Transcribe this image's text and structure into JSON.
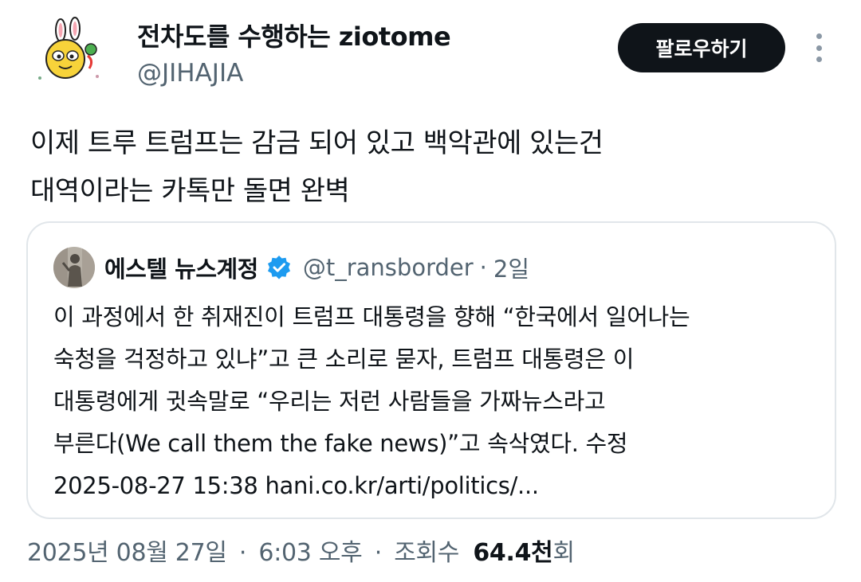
{
  "author": {
    "display_name": "전차도를 수행하는 ziotome",
    "handle": "@JIHAJIA",
    "avatar_icon": "cartoon-rabbit-avatar"
  },
  "actions": {
    "follow_label": "팔로우하기",
    "more_icon": "more-vertical-icon"
  },
  "tweet": {
    "lines": [
      "이제 트루 트럼프는 감금 되어 있고 백악관에 있는건",
      "대역이라는 카톡만 돌면 완벽"
    ]
  },
  "quote": {
    "name": "에스텔 뉴스계정",
    "verified_icon": "verified-badge-icon",
    "verified_color": "#1d9bf0",
    "handle": "@t_ransborder",
    "separator": "·",
    "age": "2일",
    "body_lines": [
      "이 과정에서 한 취재진이 트럼프 대통령을 향해 “한국에서 일어나는",
      "숙청을 걱정하고 있냐”고 큰 소리로 묻자, 트럼프 대통령은 이",
      "대통령에게 귓속말로 “우리는 저런 사람들을 가짜뉴스라고",
      "부른다(We call them the fake news)”고 속삭였다.  수정",
      "2025-08-27 15:38 hani.co.kr/arti/politics/..."
    ]
  },
  "meta": {
    "date": "2025년 08월 27일",
    "sep1": "·",
    "time": "6:03 오후",
    "sep2": "·",
    "views_label": "조회수",
    "views_count": "64.4천",
    "views_suffix": "회"
  }
}
